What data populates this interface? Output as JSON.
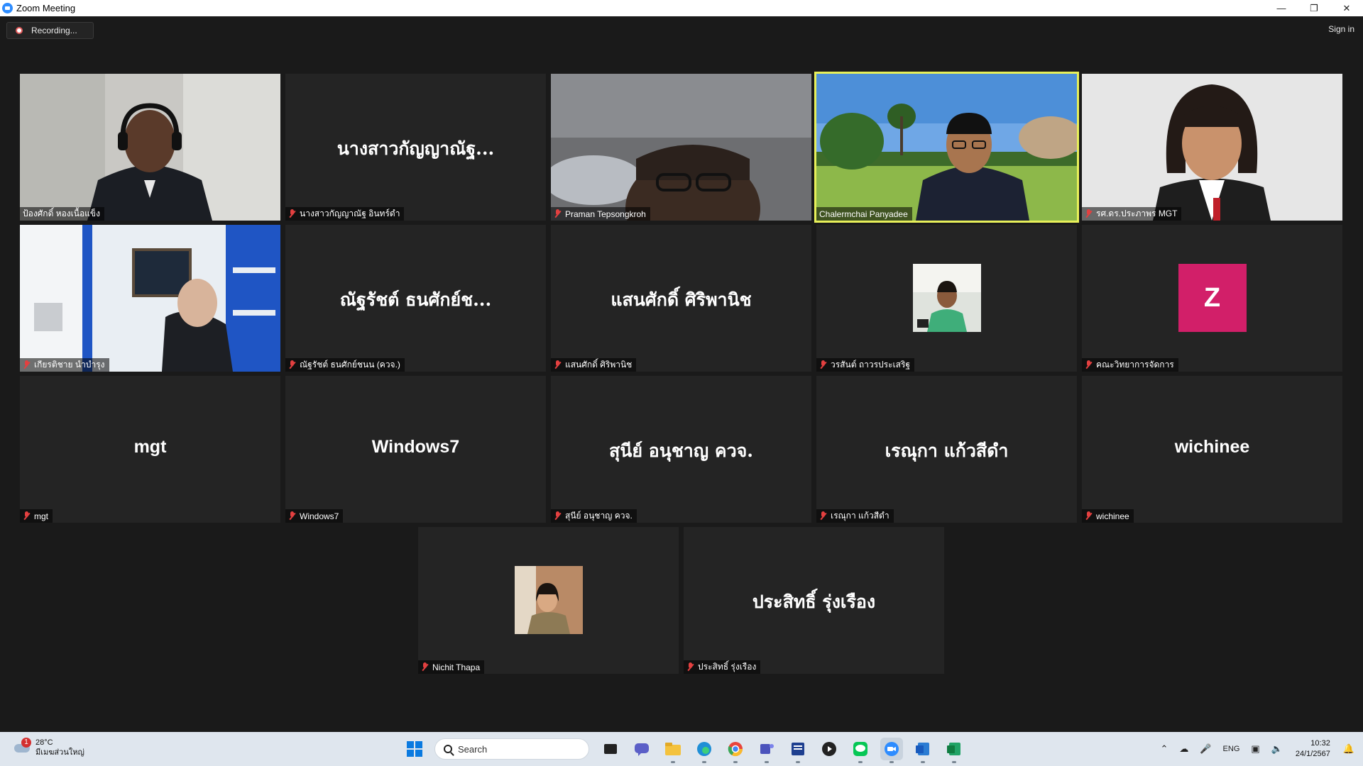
{
  "window": {
    "title": "Zoom Meeting"
  },
  "meeting": {
    "recording_label": "Recording...",
    "sign_in_label": "Sign in"
  },
  "participants": [
    {
      "tag": "ป้องศักดิ์ หองเนื้อแข็ง",
      "display": "",
      "muted": false,
      "video": "headset-man"
    },
    {
      "tag": "นางสาวกัญญาณัฐ อินทร์ดำ",
      "display": "นางสาวกัญญาณัฐ...",
      "muted": true,
      "video": ""
    },
    {
      "tag": "Praman Tepsongkroh",
      "display": "",
      "muted": true,
      "video": "glasses-man"
    },
    {
      "tag": "Chalermchai Panyadee",
      "display": "",
      "muted": false,
      "video": "outdoor-man",
      "active": true
    },
    {
      "tag": "รศ.ดร.ประภาพร MGT",
      "display": "",
      "muted": true,
      "video": "woman"
    },
    {
      "tag": "เกียรติชาย นำบำรุง",
      "display": "",
      "muted": true,
      "video": "office-man"
    },
    {
      "tag": "ณัฐรัชต์ ธนศักย์ชนน (ควจ.)",
      "display": "ณัฐรัชต์ ธนศักย์ช...",
      "muted": true,
      "video": ""
    },
    {
      "tag": "แสนศักดิ์ ศิริพานิช",
      "display": "แสนศักดิ์ ศิริพานิช",
      "muted": true,
      "video": ""
    },
    {
      "tag": "วรสันต์ ถาวรประเสริฐ",
      "display": "",
      "muted": true,
      "video": "",
      "avatar": "photo"
    },
    {
      "tag": "คณะวิทยาการจัดการ",
      "display": "",
      "muted": true,
      "video": "",
      "avatar": "Z"
    },
    {
      "tag": "mgt",
      "display": "mgt",
      "muted": true,
      "video": ""
    },
    {
      "tag": "Windows7",
      "display": "Windows7",
      "muted": true,
      "video": ""
    },
    {
      "tag": "สุนีย์ อนุชาญ ควจ.",
      "display": "สุนีย์ อนุชาญ ควจ.",
      "muted": true,
      "video": ""
    },
    {
      "tag": "เรณุกา แก้วสีดำ",
      "display": "เรณุกา แก้วสีดำ",
      "muted": true,
      "video": ""
    },
    {
      "tag": "wichinee",
      "display": "wichinee",
      "muted": true,
      "video": ""
    },
    {
      "tag": "Nichit Thapa",
      "display": "",
      "muted": true,
      "video": "",
      "avatar": "photo-woman"
    },
    {
      "tag": "ประสิทธิ์ รุ่งเรือง",
      "display": "ประสิทธิ์ รุ่งเรือง",
      "muted": true,
      "video": ""
    }
  ],
  "taskbar": {
    "weather_temp": "28°C",
    "weather_desc": "มีเมฆส่วนใหญ่",
    "weather_badge": "1",
    "search_placeholder": "Search",
    "language": "ENG",
    "time": "10:32",
    "date": "24/1/2567",
    "apps": [
      "task-view-icon",
      "teams-chat-icon",
      "file-explorer-icon",
      "edge-icon",
      "chrome-icon",
      "teams-icon",
      "news-icon",
      "media-player-icon",
      "line-icon",
      "zoom-icon",
      "word-icon",
      "excel-icon"
    ]
  },
  "colors": {
    "background": "#1a1a1a",
    "tile": "#242424",
    "active_border": "#e8f05a",
    "muted_mic": "#e34040",
    "avatar_z": "#d21f69"
  }
}
